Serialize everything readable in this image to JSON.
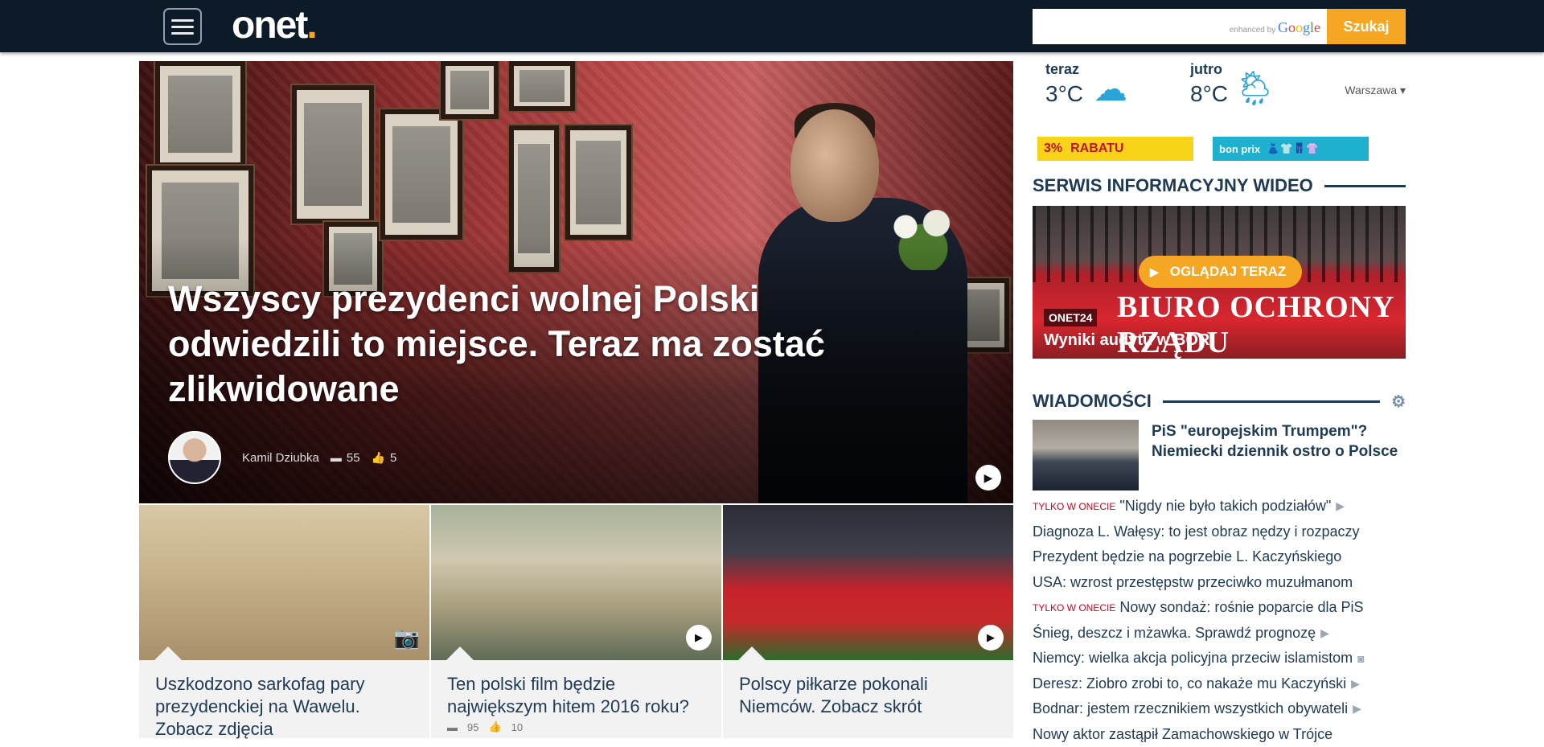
{
  "header": {
    "logo": "onet",
    "search_placeholder": "",
    "search_enhanced": "enhanced by",
    "search_google": "Google",
    "search_button": "Szukaj"
  },
  "hero": {
    "title": "Wszyscy prezydenci wolnej Polski odwiedzili to miejsce. Teraz ma zostać zlikwidowane",
    "author": "Kamil Dziubka",
    "comments": "55",
    "likes": "5"
  },
  "cards": [
    {
      "title": "Uszkodzono sarkofag pary prezydenckiej na Wawelu. Zobacz zdjęcia",
      "media": "camera-icon"
    },
    {
      "title": "Ten polski film będzie największym hitem 2016 roku?",
      "media": "play-icon",
      "comments": "95",
      "likes": "10"
    },
    {
      "title": "Polscy piłkarze pokonali Niemców. Zobacz skrót",
      "media": "play-icon"
    }
  ],
  "weather": {
    "now_label": "teraz",
    "now_temp": "3°C",
    "now_icon": "cloud-icon",
    "tomorrow_label": "jutro",
    "tomorrow_temp": "8°C",
    "tomorrow_icon": "sun-rain-icon",
    "city": "Warszawa"
  },
  "ads": {
    "ad1_text": "RABATU",
    "ad1_percent": "3%",
    "ad2_brand": "bon prix"
  },
  "video": {
    "section_title": "SERWIS INFORMACYJNY WIDEO",
    "watch_button": "OGLĄDAJ TERAZ",
    "sign_text": "BIURO OCHRONY RZĄDU",
    "tag": "ONET24",
    "caption": "Wyniki audytu w BOR"
  },
  "news": {
    "section_title": "WIADOMOŚCI",
    "lead_title": "PiS \"europejskim Trumpem\"? Niemiecki dziennik ostro o Polsce",
    "items": [
      {
        "tag": "TYLKO W ONECIE",
        "text": "\"Nigdy nie było takich podziałów\"",
        "icon": "play-icon"
      },
      {
        "tag": "",
        "text": "Diagnoza L. Wałęsy: to jest obraz nędzy i rozpaczy",
        "icon": ""
      },
      {
        "tag": "",
        "text": "Prezydent będzie na pogrzebie L. Kaczyńskiego",
        "icon": ""
      },
      {
        "tag": "",
        "text": "USA: wzrost przestępstw przeciwko muzułmanom",
        "icon": ""
      },
      {
        "tag": "TYLKO W ONECIE",
        "text": "Nowy sondaż: rośnie poparcie dla PiS",
        "icon": ""
      },
      {
        "tag": "",
        "text": "Śnieg, deszcz i mżawka. Sprawdź prognozę",
        "icon": "play-icon"
      },
      {
        "tag": "",
        "text": "Niemcy: wielka akcja policyjna przeciw islamistom",
        "icon": "camera-icon"
      },
      {
        "tag": "",
        "text": "Deresz: Ziobro zrobi to, co nakaże mu Kaczyński",
        "icon": "play-icon"
      },
      {
        "tag": "",
        "text": "Bodnar: jestem rzecznikiem wszystkich obywateli",
        "icon": "play-icon"
      },
      {
        "tag": "",
        "text": "Nowy aktor zastąpił Zamachowskiego w Trójce",
        "icon": ""
      }
    ]
  }
}
